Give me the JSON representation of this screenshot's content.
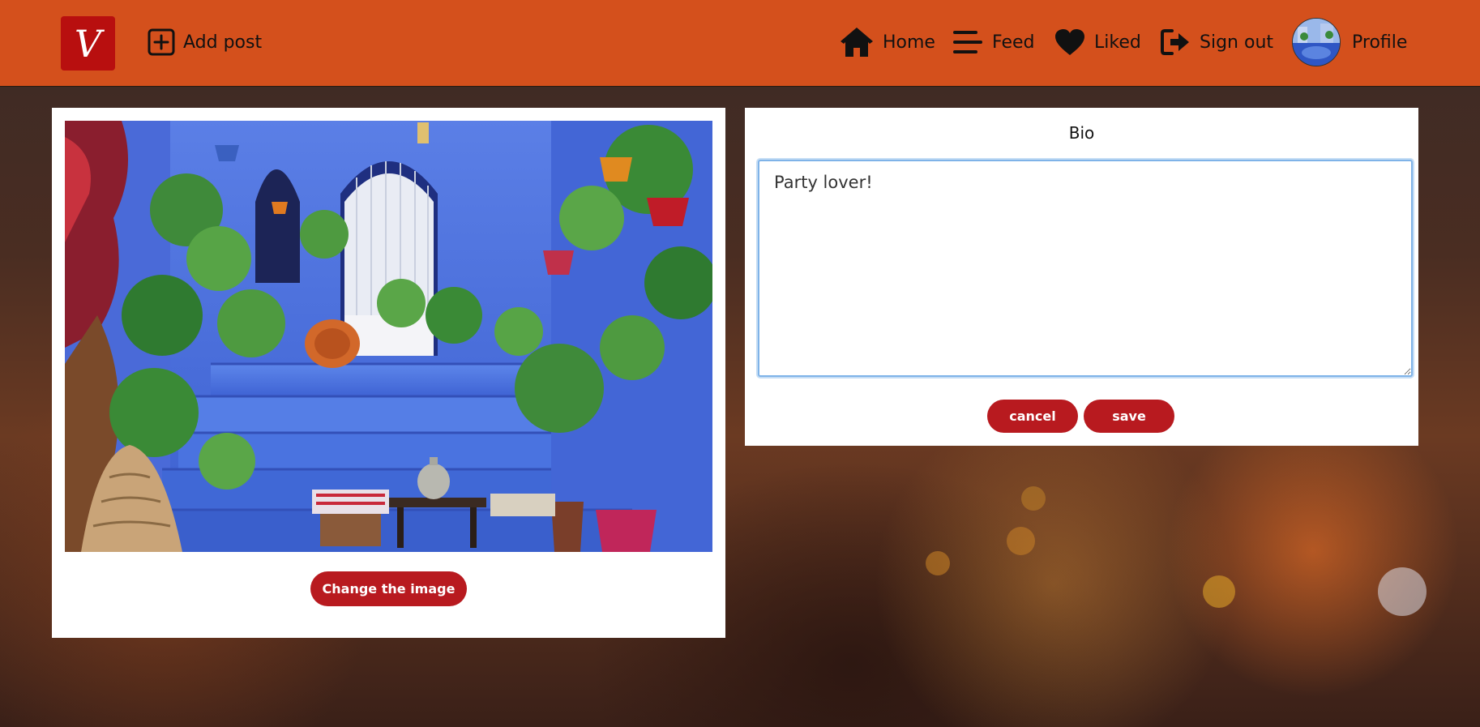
{
  "nav": {
    "logo_letter": "V",
    "add_post": "Add post",
    "home": "Home",
    "feed": "Feed",
    "liked": "Liked",
    "sign_out": "Sign out",
    "profile": "Profile"
  },
  "icons": {
    "add": "plus-square-icon",
    "home": "house-icon",
    "feed": "hamburger-lines-icon",
    "liked": "heart-icon",
    "sign_out": "sign-out-arrow-icon"
  },
  "post_image": {
    "change_label": "Change the image"
  },
  "bio": {
    "title": "Bio",
    "text": "Party lover!",
    "cancel_label": "cancel",
    "save_label": "save"
  },
  "colors": {
    "navbar": "#d4501c",
    "logo_bg": "#b80f0f",
    "button_bg": "#b81a1f",
    "textarea_focus": "#7fb3e8"
  }
}
